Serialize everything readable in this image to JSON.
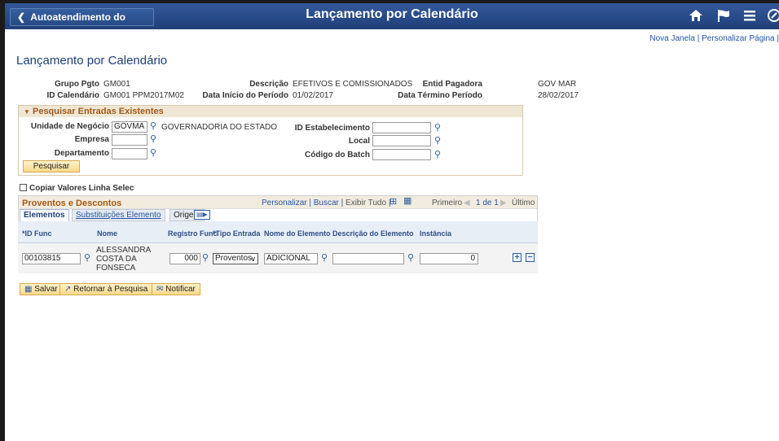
{
  "topbar": {
    "back_label": "Autoatendimento do Gerente",
    "title": "Lançamento por Calendário",
    "icons": [
      "home-icon",
      "flag-icon",
      "menu-icon",
      "navbar-icon"
    ]
  },
  "links": {
    "new_window": "Nova Janela",
    "sep": "|",
    "personalize_page": "Personalizar Página"
  },
  "page_title": "Lançamento por Calendário",
  "header": {
    "grupo_label": "Grupo Pgto",
    "grupo_value": "GM001",
    "descricao_label": "Descrição",
    "descricao_value": "EFETIVOS E COMISSIONADOS",
    "entid_label": "Entid Pagadora",
    "entid_value": "GOV MAR",
    "idcal_label": "ID Calendário",
    "idcal_value": "GM001 PPM2017M02",
    "inicio_label": "Data Início do Período",
    "inicio_value": "01/02/2017",
    "termino_label": "Data Término Período",
    "termino_value": "28/02/2017"
  },
  "search": {
    "title": "Pesquisar Entradas Existentes",
    "unidade_label": "Unidade de Negócio",
    "unidade_value": "GOVMA",
    "unidade_desc": "GOVERNADORIA DO ESTADO",
    "empresa_label": "Empresa",
    "empresa_value": "",
    "departamento_label": "Departamento",
    "departamento_value": "",
    "estab_label": "ID Estabelecimento",
    "estab_value": "",
    "local_label": "Local",
    "local_value": "",
    "batch_label": "Código do Batch",
    "batch_value": "",
    "search_button": "Pesquisar"
  },
  "copy_label": "Copiar Valores Linha Selec",
  "grid": {
    "title": "Proventos e Descontos",
    "personalizar": "Personalizar",
    "buscar": "Buscar",
    "exibir_tudo": "Exibir Tudo",
    "primeiro": "Primeiro",
    "page_info": "1 de 1",
    "ultimo": "Último",
    "tabs": [
      "Elementos",
      "Substituições Elemento",
      "Origem"
    ],
    "columns": [
      "*ID Func",
      "Nome",
      "Registro Func",
      "*Tipo Entrada",
      "Nome do Elemento",
      "Descrição do Elemento",
      "Instância"
    ],
    "row": {
      "id_func": "00103815",
      "nome_lines": [
        "ALESSANDRA",
        "COSTA DA",
        "FONSECA"
      ],
      "registro": "000",
      "tipo": "Proventos",
      "nome_elemento": "ADICIONAL",
      "descricao": "",
      "instancia": "0"
    }
  },
  "buttons": {
    "salvar": "Salvar",
    "retornar": "Retornar à Pesquisa",
    "notificar": "Notificar"
  }
}
